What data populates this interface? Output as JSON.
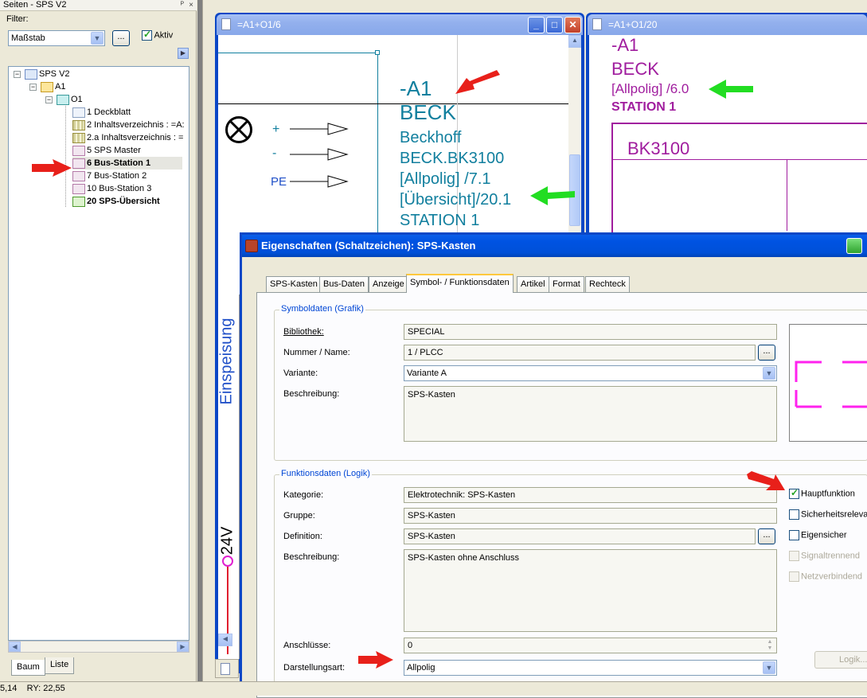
{
  "left_panel": {
    "title": "Seiten - SPS V2",
    "pin_glyph": "ᴾ",
    "close_glyph": "×",
    "filter_label": "Filter:",
    "filter_value": "Maßstab",
    "filter_more": "...",
    "active_label": "Aktiv",
    "tree": [
      {
        "label": "SPS V2",
        "level": 0,
        "icon": "sps",
        "bold": false
      },
      {
        "label": "A1",
        "level": 1,
        "icon": "folder-o",
        "bold": false
      },
      {
        "label": "O1",
        "level": 2,
        "icon": "folder-a",
        "bold": false
      },
      {
        "label": "1 Deckblatt",
        "level": 3,
        "icon": "page",
        "bold": false
      },
      {
        "label": "2 Inhaltsverzeichnis : =A:",
        "level": 3,
        "icon": "table",
        "bold": false
      },
      {
        "label": "2.a Inhaltsverzeichnis : =",
        "level": 3,
        "icon": "table",
        "bold": false
      },
      {
        "label": "5 SPS Master",
        "level": 3,
        "icon": "circuit",
        "bold": false
      },
      {
        "label": "6 Bus-Station 1",
        "level": 3,
        "icon": "circuit",
        "bold": true,
        "selected": true
      },
      {
        "label": "7 Bus-Station 2",
        "level": 3,
        "icon": "circuit",
        "bold": false
      },
      {
        "label": "10 Bus-Station 3",
        "level": 3,
        "icon": "circuit",
        "bold": false
      },
      {
        "label": "20 SPS-Übersicht",
        "level": 3,
        "icon": "overview",
        "bold": true
      }
    ],
    "tabs": {
      "tree": "Baum",
      "list": "Liste"
    }
  },
  "statusbar": {
    "text": "5,14    RY: 22,55"
  },
  "window1": {
    "title": "=A1+O1/6",
    "min_glyph": "_",
    "max_glyph": "□",
    "close_glyph": "✕",
    "labels": {
      "plus": "+",
      "minus": "-",
      "pe": "PE",
      "side": "Einspeisung",
      "volt": "24V"
    },
    "device": [
      "-A1",
      "BECK",
      "Beckhoff",
      "BECK.BK3100",
      "[Allpolig] /7.1",
      "[Übersicht]/20.1",
      "STATION 1"
    ]
  },
  "window2": {
    "title": "=A1+O1/20",
    "device": [
      "-A1",
      "BECK",
      "[Allpolig] /6.0",
      "STATION 1"
    ],
    "box_label": "BK3100"
  },
  "dialog": {
    "title": "Eigenschaften (Schaltzeichen): SPS-Kasten",
    "tabs": [
      "SPS-Kasten",
      "Bus-Daten",
      "Anzeige",
      "Symbol- / Funktionsdaten",
      "Artikel",
      "Format",
      "Rechteck"
    ],
    "symbol_group": {
      "title": "Symboldaten (Grafik)",
      "library_label": "Bibliothek:",
      "library_value": "SPECIAL",
      "number_label": "Nummer / Name:",
      "number_value": "1 / PLCC",
      "variant_label": "Variante:",
      "variant_value": "Variante A",
      "desc_label": "Beschreibung:",
      "desc_value": "SPS-Kasten"
    },
    "function_group": {
      "title": "Funktionsdaten (Logik)",
      "category_label": "Kategorie:",
      "category_value": "Elektrotechnik: SPS-Kasten",
      "group_label": "Gruppe:",
      "group_value": "SPS-Kasten",
      "definition_label": "Definition:",
      "definition_value": "SPS-Kasten",
      "desc_label": "Beschreibung:",
      "desc_value": "SPS-Kasten ohne Anschluss",
      "connections_label": "Anschlüsse:",
      "connections_value": "0",
      "display_label": "Darstellungsart:",
      "display_value": "Allpolig",
      "checkboxes": [
        {
          "label": "Hauptfunktion",
          "checked": true,
          "enabled": true
        },
        {
          "label": "Sicherheitsrelevant",
          "checked": false,
          "enabled": true
        },
        {
          "label": "Eigensicher",
          "checked": false,
          "enabled": true
        },
        {
          "label": "Signaltrennend",
          "checked": false,
          "enabled": false
        },
        {
          "label": "Netzverbindend",
          "checked": false,
          "enabled": false
        }
      ],
      "logic_button": "Logik..."
    },
    "more_glyph": "..."
  },
  "colors": {
    "teal": "#117f9e",
    "purple": "#a01d9e",
    "arrow_red": "#e8201a",
    "arrow_green": "#22dd22",
    "magenta": "#ff22ee"
  }
}
